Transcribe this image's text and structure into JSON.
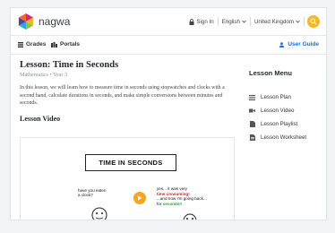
{
  "header": {
    "brand": "nagwa",
    "sign_in": "Sign In",
    "language": "English",
    "country": "United Kingdom"
  },
  "subnav": {
    "grades": "Grades",
    "portals": "Portals",
    "user_guide": "User Guide"
  },
  "lesson": {
    "title": "Lesson: Time in Seconds",
    "subtitle": "Mathematics • Year 3",
    "description": "In this lesson, we will learn how to measure time in seconds using stopwatches and clocks with a second hand, calculate durations in seconds, and make simple conversions between minutes and seconds.",
    "video_heading": "Lesson Video"
  },
  "video": {
    "title": "TIME IN SECONDS",
    "bubble_left": [
      "have you eaten",
      "a clock?"
    ],
    "bubble_right_1": "yes... it was very",
    "bubble_right_red": "time consuming!",
    "bubble_right_2": "...and now I'm going back...",
    "bubble_right_3": "for",
    "bubble_right_green": "seconds!!"
  },
  "menu": {
    "heading": "Lesson Menu",
    "items": [
      "Lesson Plan",
      "Lesson Video",
      "Lesson Playlist",
      "Lesson Worksheet"
    ]
  },
  "colors": {
    "accent": "#f6b82b",
    "link": "#1d6fd0",
    "play": "#f6a623"
  },
  "icons": [
    "nagwa-logo-icon",
    "lock-icon",
    "chevron-down-icon",
    "search-icon",
    "grid-icon",
    "portal-icon",
    "user-guide-icon",
    "list-icon",
    "video-icon",
    "playlist-icon",
    "worksheet-icon",
    "play-icon"
  ]
}
